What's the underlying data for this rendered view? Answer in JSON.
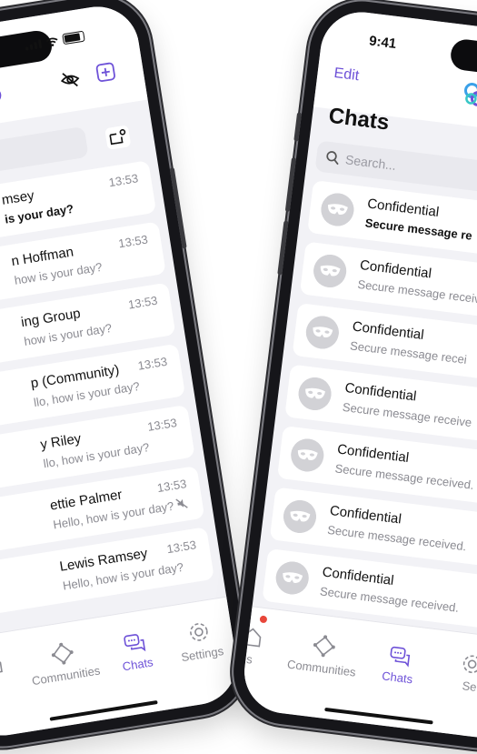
{
  "left_phone": {
    "header_icons": [
      "logo-icon",
      "eye-off-icon",
      "plus-square-icon"
    ],
    "compose_icon": "new-message-icon",
    "chats": [
      {
        "name": "msey",
        "preview": "is your day?",
        "time": "13:53",
        "unread": true
      },
      {
        "name": "n Hoffman",
        "preview": "how is your day?",
        "time": "13:53"
      },
      {
        "name": "ing Group",
        "preview": "how is your day?",
        "time": "13:53"
      },
      {
        "name": "p (Community)",
        "preview": "llo, how is your day?",
        "time": "13:53"
      },
      {
        "name": "y Riley",
        "preview": "llo, how is your day?",
        "time": "13:53"
      },
      {
        "name": "ettie Palmer",
        "preview": "Hello, how is your day?",
        "time": "13:53",
        "muted": true
      },
      {
        "name": "Lewis Ramsey",
        "preview": "Hello, how is your day?",
        "time": "13:53"
      }
    ],
    "tabs": [
      {
        "label": "",
        "icon": "home-icon"
      },
      {
        "label": "Communities",
        "icon": "communities-icon"
      },
      {
        "label": "Chats",
        "icon": "chats-icon",
        "active": true
      },
      {
        "label": "Settings",
        "icon": "gear-icon"
      }
    ]
  },
  "right_phone": {
    "status_time": "9:41",
    "edit_label": "Edit",
    "title": "Chats",
    "search_placeholder": "Search...",
    "chats": [
      {
        "name": "Confidential",
        "preview": "Secure message re",
        "unread": true
      },
      {
        "name": "Confidential",
        "preview": "Secure message receiv"
      },
      {
        "name": "Confidential",
        "preview": "Secure message recei"
      },
      {
        "name": "Confidential",
        "preview": "Secure message receive"
      },
      {
        "name": "Confidential",
        "preview": "Secure message received."
      },
      {
        "name": "Confidential",
        "preview": "Secure message received."
      },
      {
        "name": "Confidential",
        "preview": "Secure message received."
      }
    ],
    "tabs": [
      {
        "label": "s",
        "icon": "home-icon"
      },
      {
        "label": "Communities",
        "icon": "communities-icon"
      },
      {
        "label": "Chats",
        "icon": "chats-icon",
        "active": true
      },
      {
        "label": "Se",
        "icon": "gear-icon"
      }
    ]
  },
  "colors": {
    "accent": "#6e52d8",
    "logo_blue": "#3aa0e8",
    "logo_purple": "#6e52d8",
    "logo_teal": "#38c6c6"
  }
}
